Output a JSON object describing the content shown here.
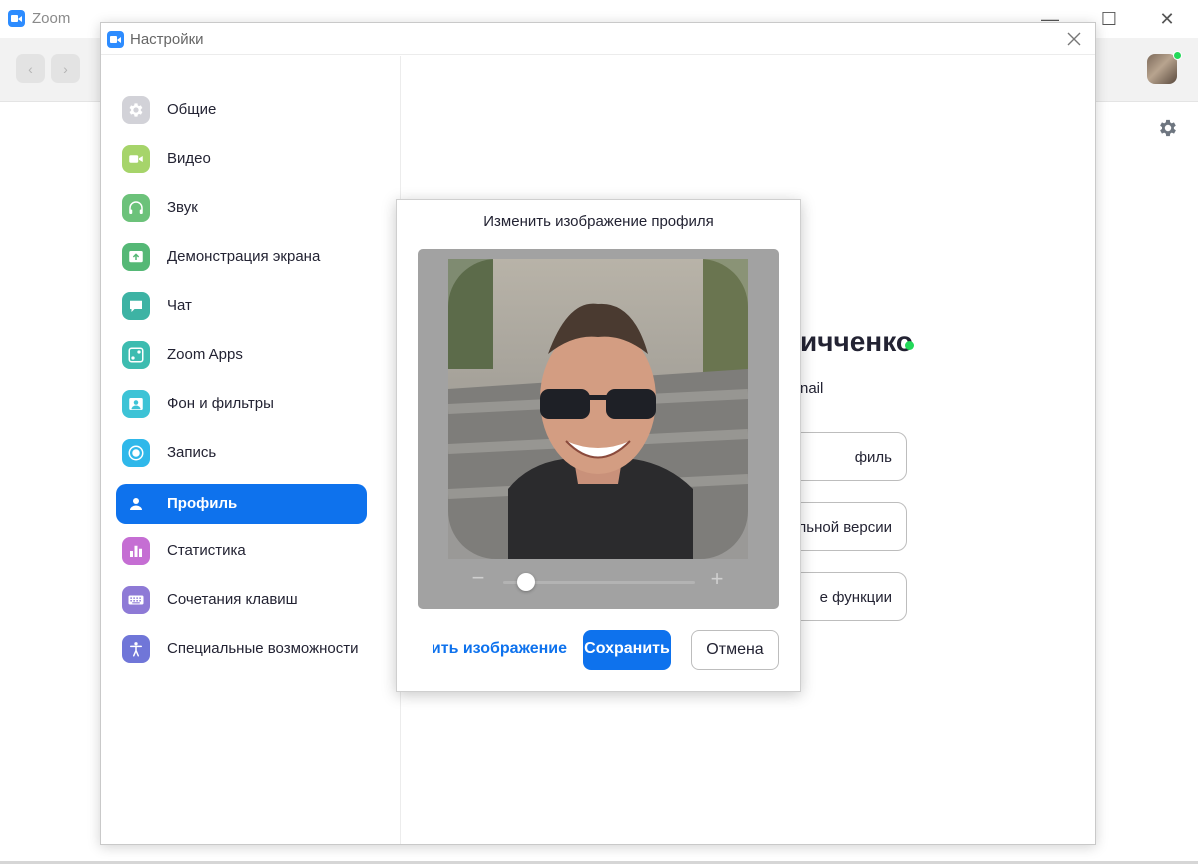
{
  "main_window": {
    "title": "Zoom",
    "controls": {
      "minimize": "—",
      "maximize": "☐",
      "close": "✕"
    },
    "nav": {
      "back": "‹",
      "forward": "›"
    }
  },
  "settings": {
    "title": "Настройки",
    "sidebar": {
      "items": [
        {
          "label": "Общие",
          "icon": "gear-icon",
          "color": "#c9c9cf"
        },
        {
          "label": "Видео",
          "icon": "video-camera-icon",
          "color": "#a6d46a"
        },
        {
          "label": "Звук",
          "icon": "headphones-icon",
          "color": "#6cc27a"
        },
        {
          "label": "Демонстрация экрана",
          "icon": "share-screen-icon",
          "color": "#55b876"
        },
        {
          "label": "Чат",
          "icon": "chat-bubble-icon",
          "color": "#3db3a4"
        },
        {
          "label": "Zoom Apps",
          "icon": "apps-icon",
          "color": "#3dbcb0"
        },
        {
          "label": "Фон и фильтры",
          "icon": "background-portrait-icon",
          "color": "#3dc3d6"
        },
        {
          "label": "Запись",
          "icon": "record-icon",
          "color": "#2fb8ea"
        },
        {
          "label": "Профиль",
          "icon": "person-icon",
          "color": "#ffffff",
          "active": true
        },
        {
          "label": "Статистика",
          "icon": "bar-chart-icon",
          "color": "#c56ed3"
        },
        {
          "label": "Сочетания клавиш",
          "icon": "keyboard-icon",
          "color": "#8e7ad6"
        },
        {
          "label": "Специальные возможности",
          "icon": "accessibility-icon",
          "color": "#7076d8"
        }
      ]
    }
  },
  "profile": {
    "name_partial": "ичченко",
    "email_partial": "nail",
    "buttons": [
      "филь",
      "льной версии",
      "е функции"
    ]
  },
  "dialog": {
    "title": "Изменить изображение профиля",
    "zoom": {
      "minus": "−",
      "plus": "+",
      "level": 0.12
    },
    "change_picture": "Изменить изображение",
    "save": "Сохранить",
    "cancel": "Отмена"
  },
  "colors": {
    "accent": "#0E72ED",
    "presence": "#23d959"
  }
}
